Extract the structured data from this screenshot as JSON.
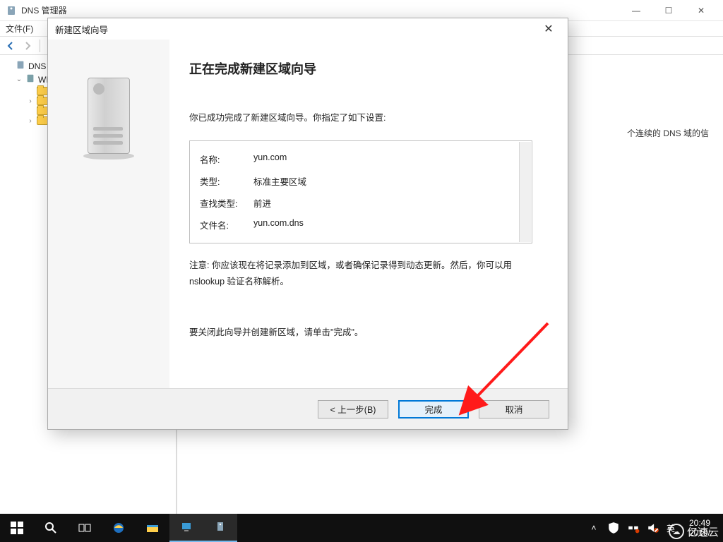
{
  "window": {
    "title": "DNS 管理器",
    "menu_file": "文件(F)"
  },
  "tree": {
    "root": "DNS",
    "server_prefix": "WI",
    "folders": [
      "",
      "",
      "",
      ""
    ]
  },
  "content_hint": "个连续的 DNS 域的信",
  "dialog": {
    "title": "新建区域向导",
    "heading": "正在完成新建区域向导",
    "success_msg": "你已成功完成了新建区域向导。你指定了如下设置:",
    "settings": [
      {
        "label": "名称:",
        "value": "yun.com"
      },
      {
        "label": "类型:",
        "value": "标准主要区域"
      },
      {
        "label": "查找类型:",
        "value": "前进"
      },
      {
        "label": "文件名:",
        "value": "yun.com.dns"
      }
    ],
    "note": "注意: 你应该现在将记录添加到区域，或者确保记录得到动态更新。然后，你可以用 nslookup 验证名称解析。",
    "close_msg": "要关闭此向导并创建新区域，请单击\"完成\"。",
    "btn_back": "< 上一步(B)",
    "btn_finish": "完成",
    "btn_cancel": "取消"
  },
  "taskbar": {
    "ime": "英",
    "time": "20:49",
    "date": "2019/"
  },
  "watermark": "亿速云"
}
